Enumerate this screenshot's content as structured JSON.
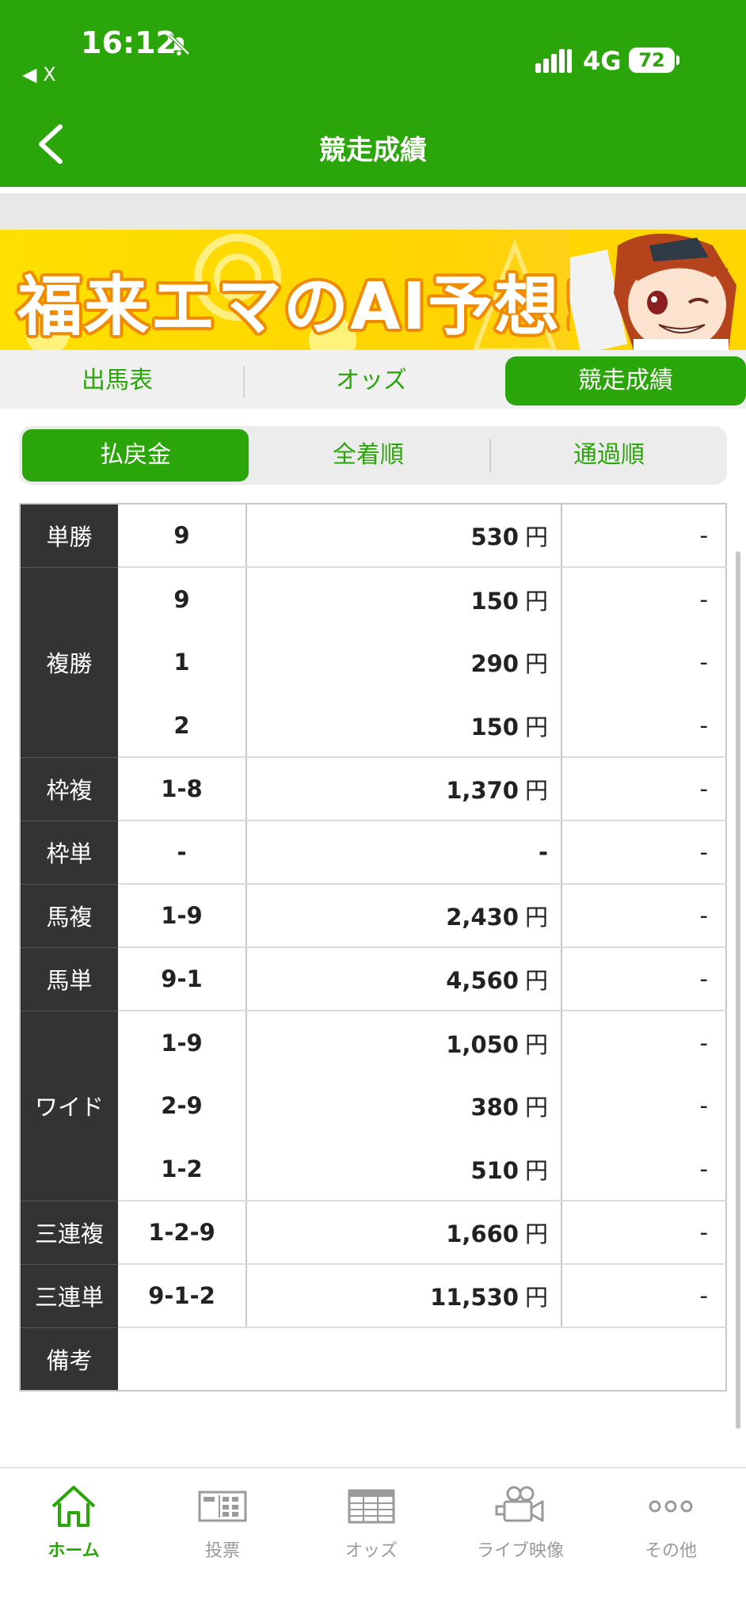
{
  "status": {
    "time": "16:12",
    "back_app": "◀ X",
    "network": "4G",
    "battery": "72"
  },
  "header": {
    "title": "競走成績"
  },
  "banner": {
    "text": "福来エマのAI予想!!"
  },
  "tabs": [
    {
      "label": "出馬表",
      "active": false
    },
    {
      "label": "オッズ",
      "active": false
    },
    {
      "label": "競走成績",
      "active": true
    }
  ],
  "subtabs": [
    {
      "label": "払戻金",
      "active": true
    },
    {
      "label": "全着順",
      "active": false
    },
    {
      "label": "通過順",
      "active": false
    }
  ],
  "payouts": {
    "yen_unit": "円",
    "groups": [
      {
        "type": "単勝",
        "rows": [
          {
            "combo": "9",
            "amount": "530",
            "popularity": "-"
          }
        ]
      },
      {
        "type": "複勝",
        "rows": [
          {
            "combo": "9",
            "amount": "150",
            "popularity": "-"
          },
          {
            "combo": "1",
            "amount": "290",
            "popularity": "-"
          },
          {
            "combo": "2",
            "amount": "150",
            "popularity": "-"
          }
        ]
      },
      {
        "type": "枠複",
        "rows": [
          {
            "combo": "1-8",
            "amount": "1,370",
            "popularity": "-"
          }
        ]
      },
      {
        "type": "枠単",
        "rows": [
          {
            "combo": "-",
            "amount": "-",
            "popularity": "-"
          }
        ]
      },
      {
        "type": "馬複",
        "rows": [
          {
            "combo": "1-9",
            "amount": "2,430",
            "popularity": "-"
          }
        ]
      },
      {
        "type": "馬単",
        "rows": [
          {
            "combo": "9-1",
            "amount": "4,560",
            "popularity": "-"
          }
        ]
      },
      {
        "type": "ワイド",
        "rows": [
          {
            "combo": "1-9",
            "amount": "1,050",
            "popularity": "-"
          },
          {
            "combo": "2-9",
            "amount": "380",
            "popularity": "-"
          },
          {
            "combo": "1-2",
            "amount": "510",
            "popularity": "-"
          }
        ]
      },
      {
        "type": "三連複",
        "rows": [
          {
            "combo": "1-2-9",
            "amount": "1,660",
            "popularity": "-"
          }
        ]
      },
      {
        "type": "三連単",
        "rows": [
          {
            "combo": "9-1-2",
            "amount": "11,530",
            "popularity": "-"
          }
        ]
      }
    ],
    "note_label": "備考",
    "note_value": ""
  },
  "bottom_nav": [
    {
      "label": "ホーム",
      "icon": "home-icon",
      "active": true
    },
    {
      "label": "投票",
      "icon": "vote-ticket-icon",
      "active": false
    },
    {
      "label": "オッズ",
      "icon": "odds-table-icon",
      "active": false
    },
    {
      "label": "ライブ映像",
      "icon": "video-camera-icon",
      "active": false
    },
    {
      "label": "その他",
      "icon": "more-dots-icon",
      "active": false
    }
  ],
  "colors": {
    "brand_green": "#2ba60a",
    "dark_cell": "#333333"
  }
}
